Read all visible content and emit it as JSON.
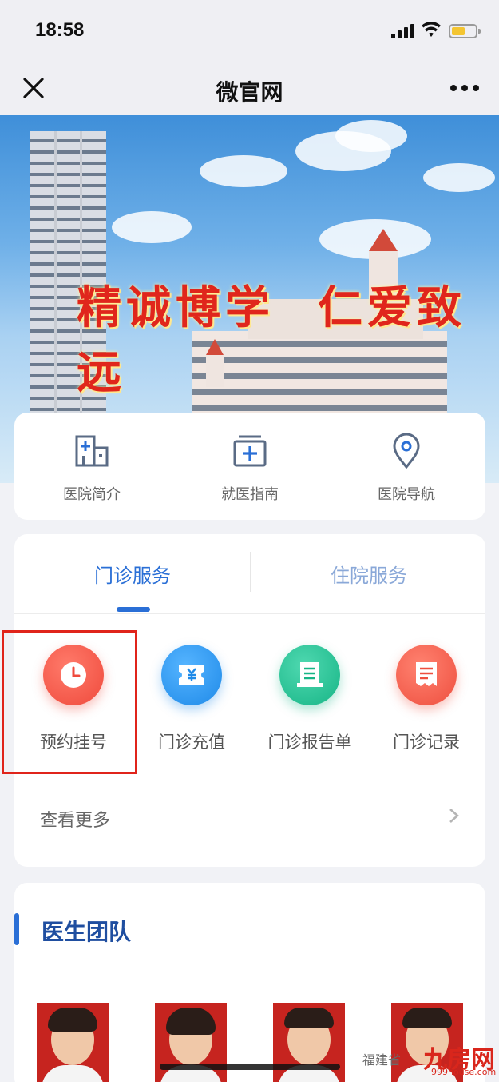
{
  "status_bar": {
    "time": "18:58"
  },
  "nav": {
    "title": "微官网",
    "close_icon": "close-icon",
    "more_icon": "more-icon"
  },
  "banner": {
    "slogan_left": "精诚博学",
    "slogan_right": "仁爱致远",
    "active_slide": 1
  },
  "quick_links": [
    {
      "label": "医院简介",
      "icon": "hospital-building-icon"
    },
    {
      "label": "就医指南",
      "icon": "medical-kit-icon"
    },
    {
      "label": "医院导航",
      "icon": "location-pin-icon"
    }
  ],
  "service": {
    "tabs": [
      {
        "label": "门诊服务",
        "active": true
      },
      {
        "label": "住院服务",
        "active": false
      }
    ],
    "items": [
      {
        "label": "预约挂号",
        "icon": "clock-icon",
        "color": "#f0574a"
      },
      {
        "label": "门诊充值",
        "icon": "yuan-ticket-icon",
        "color": "#2b96ef"
      },
      {
        "label": "门诊报告单",
        "icon": "report-icon",
        "color": "#24bf94"
      },
      {
        "label": "门诊记录",
        "icon": "record-list-icon",
        "color": "#f26452"
      }
    ],
    "more_label": "查看更多"
  },
  "doctors": {
    "title": "医生团队"
  },
  "watermark": {
    "text": "福建省",
    "logo": "九房网",
    "url": "999house.com"
  },
  "colors": {
    "accent": "#2a6fd6",
    "highlight": "#e0241b"
  }
}
